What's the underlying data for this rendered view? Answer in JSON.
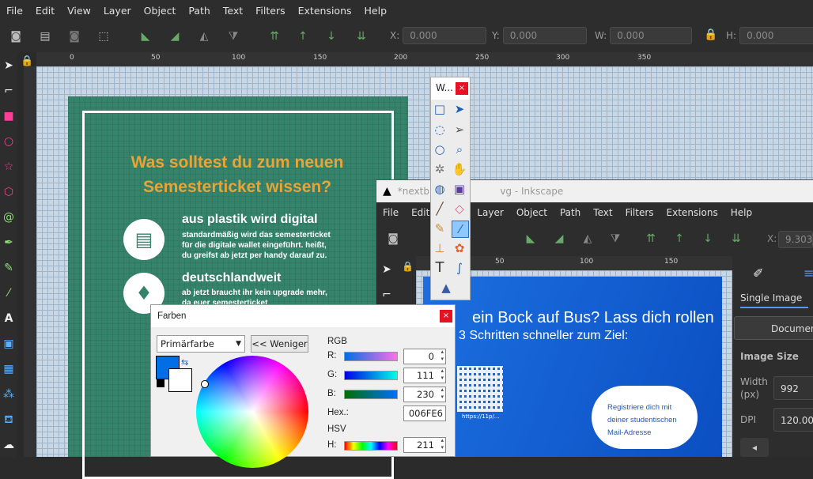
{
  "menu": [
    "File",
    "Edit",
    "View",
    "Layer",
    "Object",
    "Path",
    "Text",
    "Filters",
    "Extensions",
    "Help"
  ],
  "coords": {
    "x_label": "X:",
    "x_val": "0.000",
    "y_label": "Y:",
    "y_val": "0.000",
    "w_label": "W:",
    "w_val": "0.000",
    "h_label": "H:",
    "h_val": "0.000"
  },
  "ruler": [
    "0",
    "50",
    "100",
    "150",
    "200",
    "250",
    "300",
    "350"
  ],
  "poster": {
    "title_line1": "Was solltest du zum neuen",
    "title_line2": "Semesterticket wissen?",
    "item1_title": "aus plastik wird digital",
    "item1_text1": "standardmäßig wird das semesterticket",
    "item1_text2": "für die digitale wallet eingeführt. heißt,",
    "item1_text3": "du greifst ab jetzt per handy darauf zu.",
    "item2_title": "deutschlandweit",
    "item2_text1": "ab jetzt braucht ihr kein upgrade mehr,",
    "item2_text2": "da euer semesterticket"
  },
  "window2": {
    "title": "*nextbi",
    "title_suffix": "vg - Inkscape",
    "menu": [
      "File",
      "Edit",
      "",
      "Layer",
      "Object",
      "Path",
      "Text",
      "Filters",
      "Extensions",
      "Help"
    ],
    "x_label": "X:",
    "x_val": "9.303",
    "ruler": [
      "50",
      "100",
      "150"
    ],
    "card_title": "ein Bock auf Bus? Lass dich rollen",
    "card_sub": "3 Schritten schneller zum Ziel:",
    "qr_caption": "https://11p/...",
    "bubble_l1": "Registriere dich mit",
    "bubble_l2": "deiner studentischen",
    "bubble_l3": "Mail-Adresse"
  },
  "right_panel": {
    "tab": "Single Image",
    "button": "Document",
    "section": "Image Size",
    "width_label": "Width",
    "width_unit": "(px)",
    "width_val": "992",
    "dpi_label": "DPI",
    "dpi_val": "120.00"
  },
  "float_toolbox": {
    "title": "W..."
  },
  "farben": {
    "title": "Farben",
    "mode": "Primärfarbe",
    "less_button": "<< Weniger",
    "rgb_label": "RGB",
    "r_label": "R:",
    "r_val": "0",
    "g_label": "G:",
    "g_val": "111",
    "b_label": "B:",
    "b_val": "230",
    "hex_label": "Hex.:",
    "hex_val": "006FE6",
    "hsv_label": "HSV",
    "h_label": "H:",
    "h_val": "211",
    "color": "#006FE6"
  },
  "colors": {
    "poster_green": "#36836c",
    "title_orange": "#e8a436",
    "card_blue": "#1c6fe0"
  }
}
